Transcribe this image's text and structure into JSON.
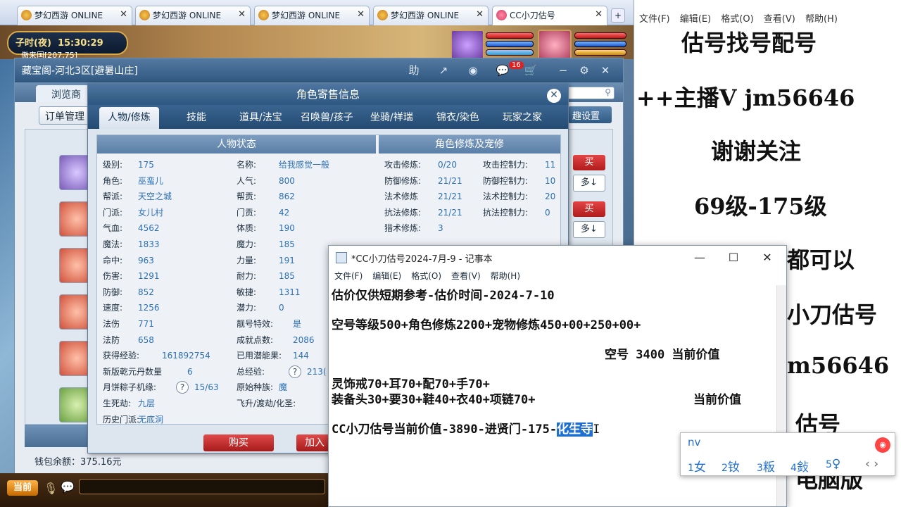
{
  "browser": {
    "tabs": [
      {
        "label": "梦幻西游 ONLINE"
      },
      {
        "label": "梦幻西游 ONLINE"
      },
      {
        "label": "梦幻西游 ONLINE"
      },
      {
        "label": "梦幻西游 ONLINE"
      },
      {
        "label": "CC小刀估号"
      }
    ],
    "new_tab": "+"
  },
  "game": {
    "time_period": "子时(夜)",
    "time": "15:30:29",
    "location": "傲来国[207,75]",
    "now_button": "当前"
  },
  "store": {
    "title": "藏宝阁-河北3区[避暑山庄]",
    "header_icons": [
      "助",
      "↗",
      "◉",
      "💬",
      "🛒",
      "−",
      "⚙",
      "✕"
    ],
    "message_count": "16",
    "browse_tab": "浏览商",
    "order_button": "订单管理",
    "fav_button": "趣设置",
    "buy_label": "买",
    "more_label": "多↓",
    "wallet_label": "钱包余额：",
    "wallet_value": "375.16元"
  },
  "dialog": {
    "title": "角色寄售信息",
    "close": "✕",
    "tabs": [
      "人物/修炼",
      "技能",
      "道具/法宝",
      "召唤兽/孩子",
      "坐骑/祥瑞",
      "锦衣/染色",
      "玩家之家"
    ],
    "left_section": "人物状态",
    "right_section": "角色修炼及宠修",
    "stats_left": [
      {
        "k": "级别:",
        "v": "175"
      },
      {
        "k": "角色:",
        "v": "巫蛮儿"
      },
      {
        "k": "帮派:",
        "v": "天空之城"
      },
      {
        "k": "门派:",
        "v": "女儿村"
      },
      {
        "k": "气血:",
        "v": "4562"
      },
      {
        "k": "魔法:",
        "v": "1833"
      },
      {
        "k": "命中:",
        "v": "963"
      },
      {
        "k": "伤害:",
        "v": "1291"
      },
      {
        "k": "防御:",
        "v": "852"
      },
      {
        "k": "速度:",
        "v": "1256"
      },
      {
        "k": "法伤",
        "v": "771"
      },
      {
        "k": "法防",
        "v": "658"
      },
      {
        "k": "获得经验:",
        "v": "161892754"
      },
      {
        "k": "新版乾元丹数量",
        "v": "6"
      },
      {
        "k": "月饼粽子机缘:",
        "v": "15/63"
      },
      {
        "k": "生死劫:",
        "v": "九层"
      },
      {
        "k": "历史门派:",
        "v": "无底洞"
      }
    ],
    "stats_mid": [
      {
        "k": "名称:",
        "v": "给我感觉一般"
      },
      {
        "k": "人气:",
        "v": "800"
      },
      {
        "k": "帮贡:",
        "v": "862"
      },
      {
        "k": "门贡:",
        "v": "42"
      },
      {
        "k": "体质:",
        "v": "190"
      },
      {
        "k": "魔力:",
        "v": "185"
      },
      {
        "k": "力量:",
        "v": "191"
      },
      {
        "k": "耐力:",
        "v": "185"
      },
      {
        "k": "敏捷:",
        "v": "1311"
      },
      {
        "k": "潜力:",
        "v": "0"
      },
      {
        "k": "靓号特效:",
        "v": "是"
      },
      {
        "k": "成就点数:",
        "v": "2086"
      },
      {
        "k": "已用潜能果:",
        "v": "144"
      },
      {
        "k": "总经验:",
        "v": "213("
      },
      {
        "k": "原始种族:",
        "v": "魔"
      },
      {
        "k": "飞升/渡劫/化圣:",
        "v": ""
      }
    ],
    "cultivation": [
      {
        "k": "攻击修炼:",
        "v": "0/20",
        "k2": "攻击控制力:",
        "v2": "11"
      },
      {
        "k": "防御修炼:",
        "v": "21/21",
        "k2": "防御控制力:",
        "v2": "10"
      },
      {
        "k": "法术修炼",
        "v": "21/21",
        "k2": "法术控制力:",
        "v2": "20"
      },
      {
        "k": "抗法修炼:",
        "v": "21/21",
        "k2": "抗法控制力:",
        "v2": "0"
      },
      {
        "k": "猎术修炼:",
        "v": "3",
        "k2": "",
        "v2": ""
      }
    ],
    "help_icon": "?",
    "buy_button": "购买",
    "cart_button": "加入"
  },
  "notepad_bg": {
    "menu": [
      "文件(F)",
      "编辑(E)",
      "格式(O)",
      "查看(V)",
      "帮助(H)"
    ],
    "lines": [
      "估号找号配号",
      "++主播V jm56646",
      "谢谢关注",
      "69级-175级",
      "都可以",
      "小刀估号",
      "m56646",
      "估号",
      "电脑版"
    ]
  },
  "notepad": {
    "title": "*CC小刀估号2024-7月-9 - 记事本",
    "menu": [
      "文件(F)",
      "编辑(E)",
      "格式(O)",
      "查看(V)",
      "帮助(H)"
    ],
    "controls": [
      "—",
      "☐",
      "✕"
    ],
    "lines": [
      "估价仅供短期参考-估价时间-2024-7-10",
      "空号等级500+角色修炼2200+宠物修炼450+00+250+00+",
      "空号 3400 当前价值",
      "灵饰戒70+耳70+配70+手70+",
      "装备头30+要30+鞋40+衣40+项链70+",
      "当前价值",
      "CC小刀估号当前价值-3890-进贤门-175-",
      "化生寺"
    ]
  },
  "ime": {
    "composition": "nv",
    "candidates": [
      {
        "n": "1",
        "t": "女"
      },
      {
        "n": "2",
        "t": "钕"
      },
      {
        "n": "3",
        "t": "粄"
      },
      {
        "n": "4",
        "t": "鈙"
      },
      {
        "n": "5",
        "t": "♀"
      }
    ],
    "nav": "‹ ›"
  }
}
